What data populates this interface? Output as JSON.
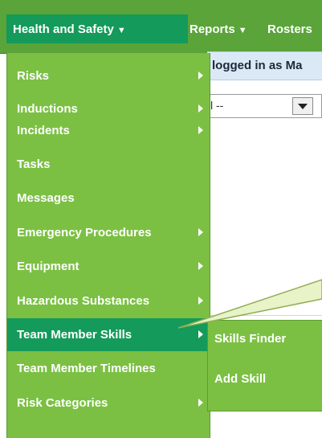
{
  "nav": {
    "tabs": [
      {
        "label": "Health and Safety",
        "caret": "▼"
      },
      {
        "label": "Reports",
        "caret": "▼"
      },
      {
        "label": "Rosters"
      }
    ]
  },
  "content": {
    "info_text": "logged in as Ma",
    "select_value": "l --"
  },
  "menu": {
    "items": [
      {
        "label": "Risks"
      },
      {
        "label": "Inductions"
      },
      {
        "label": "Incidents"
      },
      {
        "label": "Tasks"
      },
      {
        "label": "Messages"
      },
      {
        "label": "Emergency Procedures"
      },
      {
        "label": "Equipment"
      },
      {
        "label": "Hazardous Substances"
      },
      {
        "label": "Team Member Skills"
      },
      {
        "label": "Team Member Timelines"
      },
      {
        "label": "Risk Categories"
      }
    ]
  },
  "submenu": {
    "items": [
      {
        "label": "Skills Finder"
      },
      {
        "label": "Add Skill"
      }
    ]
  },
  "colors": {
    "menu_bg": "#7bc043",
    "menu_highlight": "#149a5a",
    "topbar_bg": "#5aa43a",
    "info_bg": "#dbe9f7",
    "callout_fill": "#e8f3c8"
  },
  "icons": {
    "submenu_arrow": "triangle-right-icon",
    "tab_caret": "caret-down-icon",
    "select_arrow": "triangle-down-icon"
  }
}
